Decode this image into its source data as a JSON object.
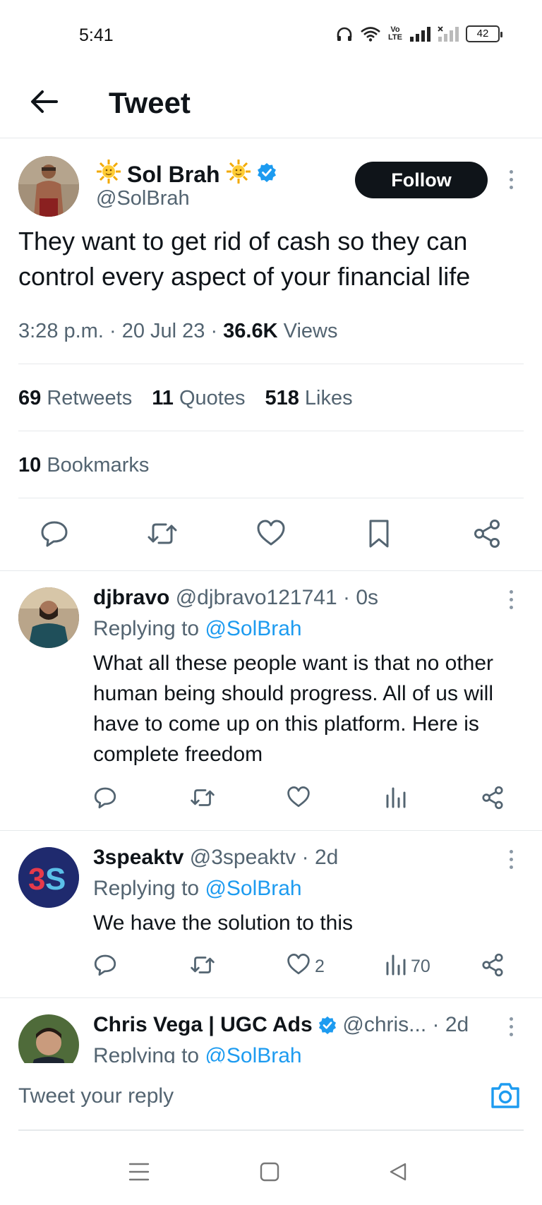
{
  "status_bar": {
    "time": "5:41",
    "battery": "42",
    "volte_top": "Vo",
    "volte_bottom": "LTE"
  },
  "header": {
    "title": "Tweet"
  },
  "tweet": {
    "author_name": "Sol Brah",
    "handle": "@SolBrah",
    "follow_label": "Follow",
    "text": "They want to get rid of cash so they can control every aspect of your financial life",
    "time": "3:28 p.m.",
    "date": "20 Jul 23",
    "views_count": "36.6K",
    "views_label": "Views",
    "retweets_count": "69",
    "retweets_label": "Retweets",
    "quotes_count": "11",
    "quotes_label": "Quotes",
    "likes_count": "518",
    "likes_label": "Likes",
    "bookmarks_count": "10",
    "bookmarks_label": "Bookmarks"
  },
  "replies": [
    {
      "name": "djbravo",
      "handle": "@djbravo121741",
      "age": "0s",
      "replying_label": "Replying to",
      "replying_to": "@SolBrah",
      "text": "What all these people want is that no other human being should progress. All of us will have to come up on this platform. Here is complete freedom",
      "likes": "",
      "views": ""
    },
    {
      "name": "3speaktv",
      "handle": "@3speaktv",
      "age": "2d",
      "replying_label": "Replying to",
      "replying_to": "@SolBrah",
      "text": "We have the solution to this",
      "likes": "2",
      "views": "70"
    },
    {
      "name": "Chris Vega | UGC Ads",
      "handle": "@chris...",
      "age": "2d",
      "replying_label": "Replying to",
      "replying_to": "@SolBrah"
    }
  ],
  "reply_bar": {
    "placeholder": "Tweet your reply"
  },
  "colors": {
    "accent": "#1d9bf0",
    "text": "#0f1419",
    "secondary": "#536471",
    "verified": "#1d9bf0"
  }
}
